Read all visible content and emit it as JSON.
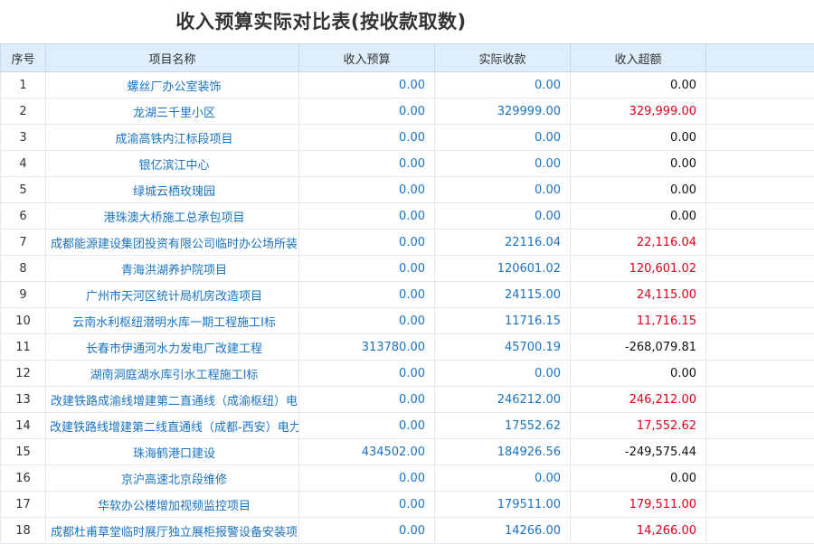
{
  "title": "收入预算实际对比表(按收款取数)",
  "colors": {
    "header_bg": "#dfeefb",
    "link_blue": "#1a73c2",
    "positive_red": "#e0001b"
  },
  "columns": [
    "序号",
    "项目名称",
    "收入预算",
    "实际收款",
    "收入超额"
  ],
  "rows": [
    {
      "no": "1",
      "name": "螺丝厂办公室装饰",
      "budget": "0.00",
      "actual": "0.00",
      "over": "0.00",
      "positive": false
    },
    {
      "no": "2",
      "name": "龙湖三千里小区",
      "budget": "0.00",
      "actual": "329999.00",
      "over": "329,999.00",
      "positive": true
    },
    {
      "no": "3",
      "name": "成渝高铁内江标段项目",
      "budget": "0.00",
      "actual": "0.00",
      "over": "0.00",
      "positive": false
    },
    {
      "no": "4",
      "name": "银亿滨江中心",
      "budget": "0.00",
      "actual": "0.00",
      "over": "0.00",
      "positive": false
    },
    {
      "no": "5",
      "name": "绿城云栖玫瑰园",
      "budget": "0.00",
      "actual": "0.00",
      "over": "0.00",
      "positive": false
    },
    {
      "no": "6",
      "name": "港珠澳大桥施工总承包项目",
      "budget": "0.00",
      "actual": "0.00",
      "over": "0.00",
      "positive": false
    },
    {
      "no": "7",
      "name": "成都能源建设集团投资有限公司临时办公场所装",
      "budget": "0.00",
      "actual": "22116.04",
      "over": "22,116.04",
      "positive": true
    },
    {
      "no": "8",
      "name": "青海洪湖养护院项目",
      "budget": "0.00",
      "actual": "120601.02",
      "over": "120,601.02",
      "positive": true
    },
    {
      "no": "9",
      "name": "广州市天河区统计局机房改造项目",
      "budget": "0.00",
      "actual": "24115.00",
      "over": "24,115.00",
      "positive": true
    },
    {
      "no": "10",
      "name": "云南水利枢纽潜明水库一期工程施工I标",
      "budget": "0.00",
      "actual": "11716.15",
      "over": "11,716.15",
      "positive": true
    },
    {
      "no": "11",
      "name": "长春市伊通河水力发电厂改建工程",
      "budget": "313780.00",
      "actual": "45700.19",
      "over": "-268,079.81",
      "positive": false
    },
    {
      "no": "12",
      "name": "湖南洞庭湖水库引水工程施工I标",
      "budget": "0.00",
      "actual": "0.00",
      "over": "0.00",
      "positive": false
    },
    {
      "no": "13",
      "name": "改建铁路成渝线增建第二直通线（成渝枢纽）电",
      "budget": "0.00",
      "actual": "246212.00",
      "over": "246,212.00",
      "positive": true
    },
    {
      "no": "14",
      "name": "改建铁路线增建第二线直通线（成都-西安）电力",
      "budget": "0.00",
      "actual": "17552.62",
      "over": "17,552.62",
      "positive": true
    },
    {
      "no": "15",
      "name": "珠海鹤港口建设",
      "budget": "434502.00",
      "actual": "184926.56",
      "over": "-249,575.44",
      "positive": false
    },
    {
      "no": "16",
      "name": "京沪高速北京段维修",
      "budget": "0.00",
      "actual": "0.00",
      "over": "0.00",
      "positive": false
    },
    {
      "no": "17",
      "name": "华软办公楼增加视频监控项目",
      "budget": "0.00",
      "actual": "179511.00",
      "over": "179,511.00",
      "positive": true
    },
    {
      "no": "18",
      "name": "成都杜甫草堂临时展厅独立展柜报警设备安装项",
      "budget": "0.00",
      "actual": "14266.00",
      "over": "14,266.00",
      "positive": true
    }
  ]
}
